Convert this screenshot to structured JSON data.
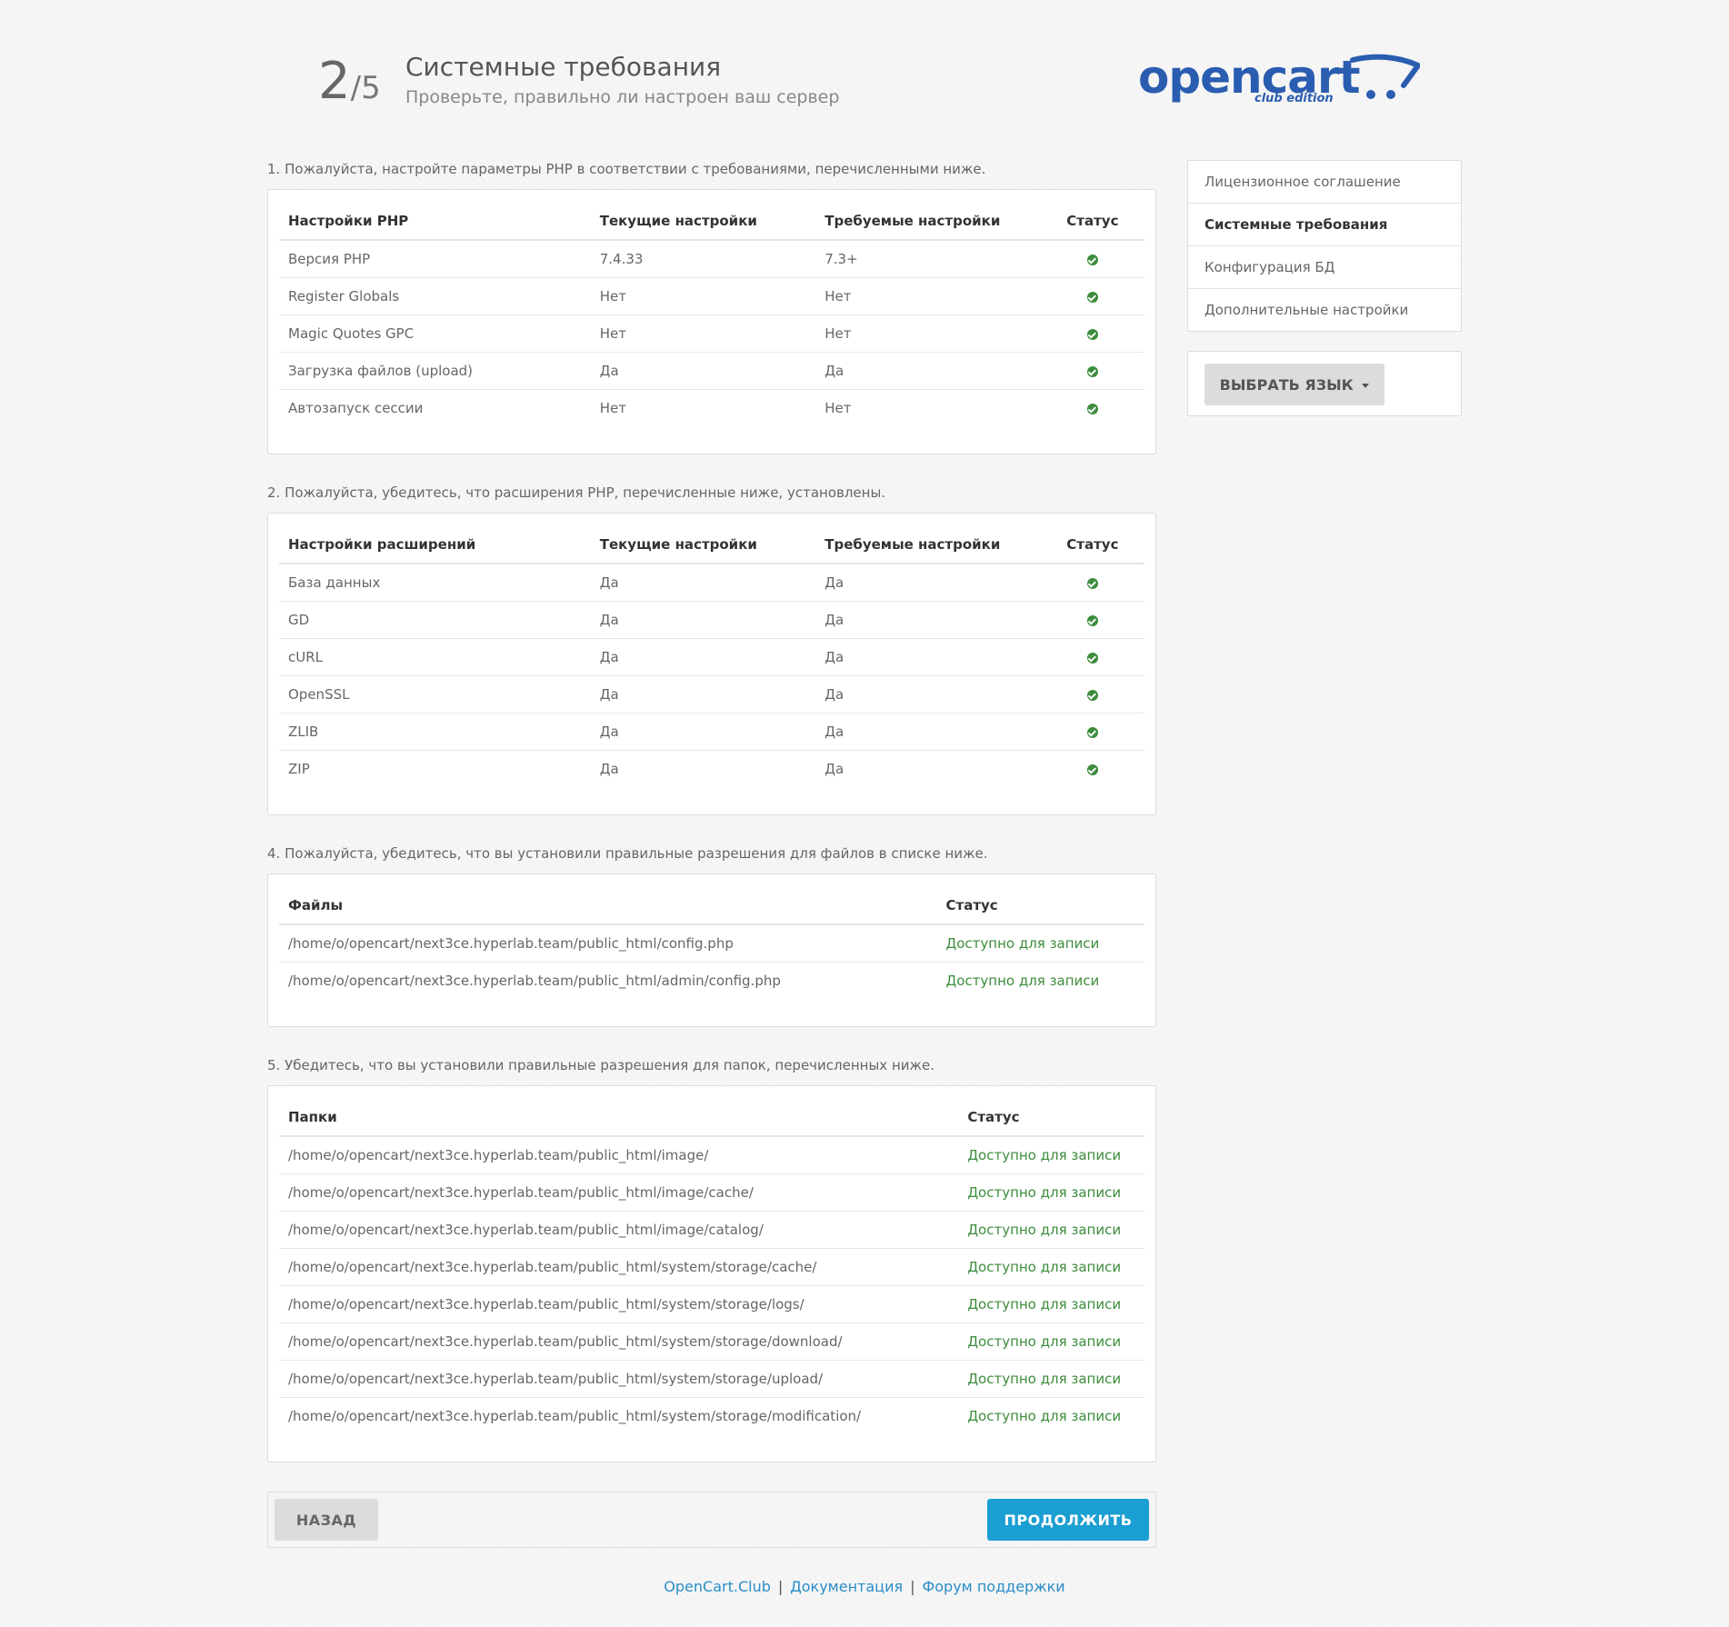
{
  "header": {
    "step_current": "2",
    "step_total": "/5",
    "title": "Системные требования",
    "subtitle": "Проверьте, правильно ли настроен ваш сервер",
    "logo_text": "opencart",
    "logo_sub": "club edition"
  },
  "php": {
    "label": "1. Пожалуйста, настройте параметры PHP в соответствии с требованиями, перечисленными ниже.",
    "headers": [
      "Настройки PHP",
      "Текущие настройки",
      "Требуемые настройки",
      "Статус"
    ],
    "rows": [
      {
        "name": "Версия PHP",
        "current": "7.4.33",
        "required": "7.3+"
      },
      {
        "name": "Register Globals",
        "current": "Нет",
        "required": "Нет"
      },
      {
        "name": "Magic Quotes GPC",
        "current": "Нет",
        "required": "Нет"
      },
      {
        "name": "Загрузка файлов (upload)",
        "current": "Да",
        "required": "Да"
      },
      {
        "name": "Автозапуск сессии",
        "current": "Нет",
        "required": "Нет"
      }
    ]
  },
  "ext": {
    "label": "2. Пожалуйста, убедитесь, что расширения PHP, перечисленные ниже, установлены.",
    "headers": [
      "Настройки расширений",
      "Текущие настройки",
      "Требуемые настройки",
      "Статус"
    ],
    "rows": [
      {
        "name": "База данных",
        "current": "Да",
        "required": "Да"
      },
      {
        "name": "GD",
        "current": "Да",
        "required": "Да"
      },
      {
        "name": "cURL",
        "current": "Да",
        "required": "Да"
      },
      {
        "name": "OpenSSL",
        "current": "Да",
        "required": "Да"
      },
      {
        "name": "ZLIB",
        "current": "Да",
        "required": "Да"
      },
      {
        "name": "ZIP",
        "current": "Да",
        "required": "Да"
      }
    ]
  },
  "files": {
    "label": "4. Пожалуйста, убедитесь, что вы установили правильные разрешения для файлов в списке ниже.",
    "headers": [
      "Файлы",
      "Статус"
    ],
    "rows": [
      {
        "path": "/home/o/opencart/next3ce.hyperlab.team/public_html/config.php",
        "status": "Доступно для записи"
      },
      {
        "path": "/home/o/opencart/next3ce.hyperlab.team/public_html/admin/config.php",
        "status": "Доступно для записи"
      }
    ]
  },
  "folders": {
    "label": "5. Убедитесь, что вы установили правильные разрешения для папок, перечисленных ниже.",
    "headers": [
      "Папки",
      "Статус"
    ],
    "rows": [
      {
        "path": "/home/o/opencart/next3ce.hyperlab.team/public_html/image/",
        "status": "Доступно для записи"
      },
      {
        "path": "/home/o/opencart/next3ce.hyperlab.team/public_html/image/cache/",
        "status": "Доступно для записи"
      },
      {
        "path": "/home/o/opencart/next3ce.hyperlab.team/public_html/image/catalog/",
        "status": "Доступно для записи"
      },
      {
        "path": "/home/o/opencart/next3ce.hyperlab.team/public_html/system/storage/cache/",
        "status": "Доступно для записи"
      },
      {
        "path": "/home/o/opencart/next3ce.hyperlab.team/public_html/system/storage/logs/",
        "status": "Доступно для записи"
      },
      {
        "path": "/home/o/opencart/next3ce.hyperlab.team/public_html/system/storage/download/",
        "status": "Доступно для записи"
      },
      {
        "path": "/home/o/opencart/next3ce.hyperlab.team/public_html/system/storage/upload/",
        "status": "Доступно для записи"
      },
      {
        "path": "/home/o/opencart/next3ce.hyperlab.team/public_html/system/storage/modification/",
        "status": "Доступно для записи"
      }
    ]
  },
  "buttons": {
    "back": "НАЗАД",
    "continue": "ПРОДОЛЖИТЬ",
    "language": "ВЫБРАТЬ ЯЗЫК"
  },
  "sidebar": {
    "items": [
      {
        "label": "Лицензионное соглашение",
        "active": false
      },
      {
        "label": "Системные требования",
        "active": true
      },
      {
        "label": "Конфигурация БД",
        "active": false
      },
      {
        "label": "Дополнительные настройки",
        "active": false
      }
    ]
  },
  "footer": {
    "links": [
      "OpenCart.Club",
      "Документация",
      "Форум поддержки"
    ],
    "separator": "|"
  },
  "icons": {
    "status_ok": "check-circle-icon",
    "language_caret": "caret-down-icon",
    "logo_cart": "cart-icon"
  },
  "colors": {
    "brand": "#2a5db0",
    "ok": "#3c8c3c",
    "primary_button": "#1b9ed1",
    "link": "#2a8dc8"
  }
}
